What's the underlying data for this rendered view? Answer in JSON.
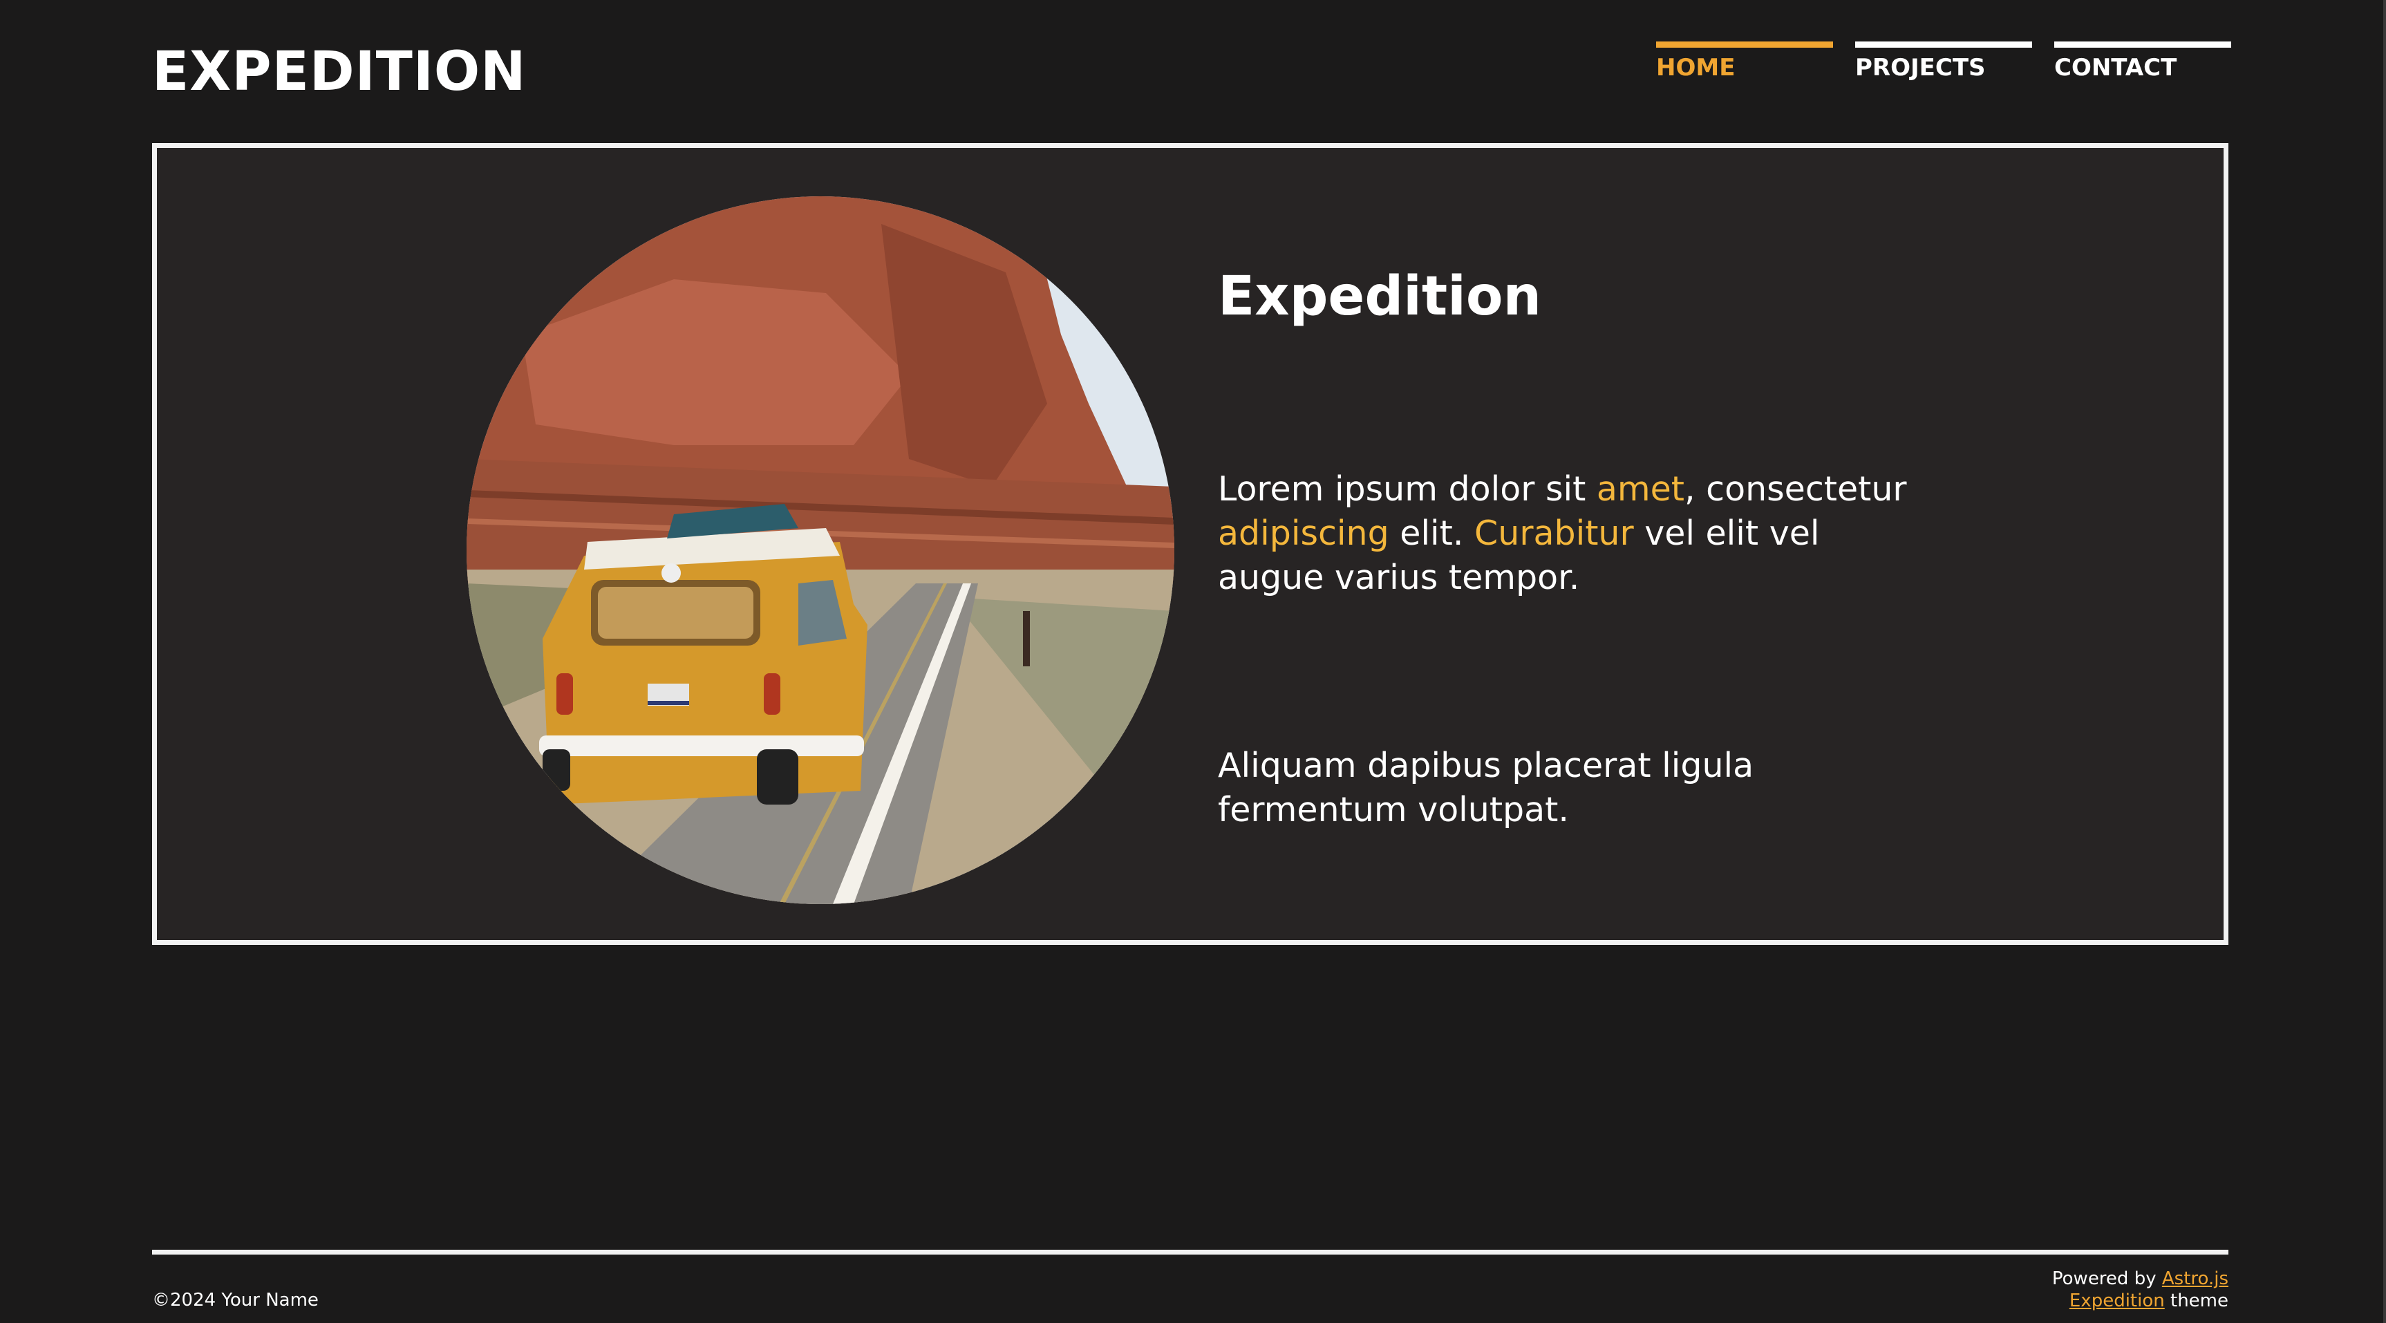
{
  "header": {
    "logo": "EXPEDITION",
    "nav": [
      {
        "label": "HOME",
        "active": true
      },
      {
        "label": "PROJECTS",
        "active": false
      },
      {
        "label": "CONTACT",
        "active": false
      }
    ]
  },
  "hero": {
    "title": "Expedition",
    "paragraph1": {
      "t1": "Lorem ipsum dolor sit ",
      "h1": "amet",
      "t2": ", consectetur ",
      "h2": "adipiscing",
      "t3": " elit. ",
      "h3": "Curabitur",
      "t4": " vel elit vel augue varius tempor."
    },
    "paragraph2": "Aliquam dapibus placerat ligula fermentum volutpat."
  },
  "footer": {
    "copyright": "©2024 Your Name",
    "powered_prefix": "Powered by ",
    "powered_link": "Astro.js",
    "theme_link": "Expedition",
    "theme_suffix": " theme"
  },
  "colors": {
    "background": "#1b1a1a",
    "card": "#272424",
    "accent": "#f0a531",
    "highlight": "#f4b73c",
    "text": "#ffffff"
  }
}
